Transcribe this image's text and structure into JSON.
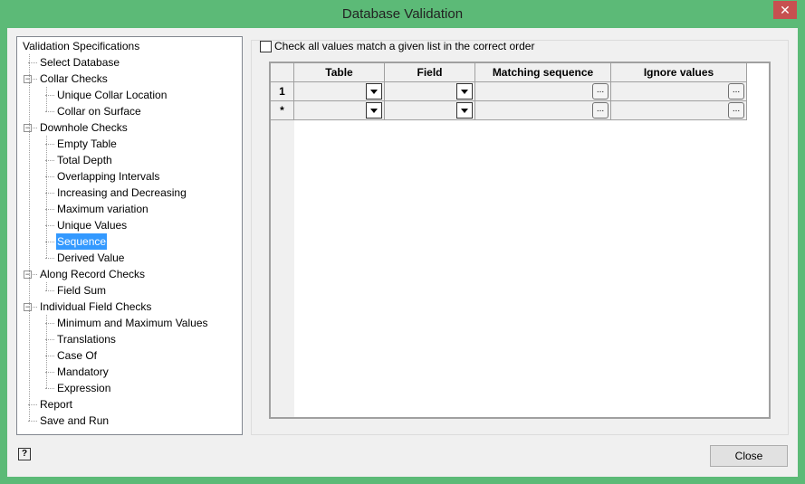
{
  "window": {
    "title": "Database Validation",
    "close": "✕"
  },
  "tree": [
    {
      "label": "Validation Specifications",
      "level": 0
    },
    {
      "label": "Select Database",
      "level": 1
    },
    {
      "label": "Collar Checks",
      "level": 1,
      "expanded": true
    },
    {
      "label": "Unique Collar Location",
      "level": 2
    },
    {
      "label": "Collar on Surface",
      "level": 2
    },
    {
      "label": "Downhole Checks",
      "level": 1,
      "expanded": true
    },
    {
      "label": "Empty Table",
      "level": 2
    },
    {
      "label": "Total Depth",
      "level": 2
    },
    {
      "label": "Overlapping Intervals",
      "level": 2
    },
    {
      "label": "Increasing and Decreasing",
      "level": 2
    },
    {
      "label": "Maximum variation",
      "level": 2
    },
    {
      "label": "Unique Values",
      "level": 2
    },
    {
      "label": "Sequence",
      "level": 2,
      "selected": true
    },
    {
      "label": "Derived Value",
      "level": 2
    },
    {
      "label": "Along Record Checks",
      "level": 1,
      "expanded": true
    },
    {
      "label": "Field Sum",
      "level": 2
    },
    {
      "label": "Individual Field Checks",
      "level": 1,
      "expanded": true
    },
    {
      "label": "Minimum and Maximum Values",
      "level": 2
    },
    {
      "label": "Translations",
      "level": 2
    },
    {
      "label": "Case Of",
      "level": 2
    },
    {
      "label": "Mandatory",
      "level": 2
    },
    {
      "label": "Expression",
      "level": 2
    },
    {
      "label": "Report",
      "level": 1
    },
    {
      "label": "Save and Run",
      "level": 1
    }
  ],
  "options": {
    "check_order_label": "Check all values match a given list in the correct order",
    "check_order_checked": false
  },
  "grid": {
    "columns": [
      "Table",
      "Field",
      "Matching sequence",
      "Ignore values"
    ],
    "rows": [
      {
        "header": "1"
      },
      {
        "header": "*"
      }
    ],
    "ellipsis": "..."
  },
  "buttons": {
    "close": "Close",
    "help": "?"
  }
}
